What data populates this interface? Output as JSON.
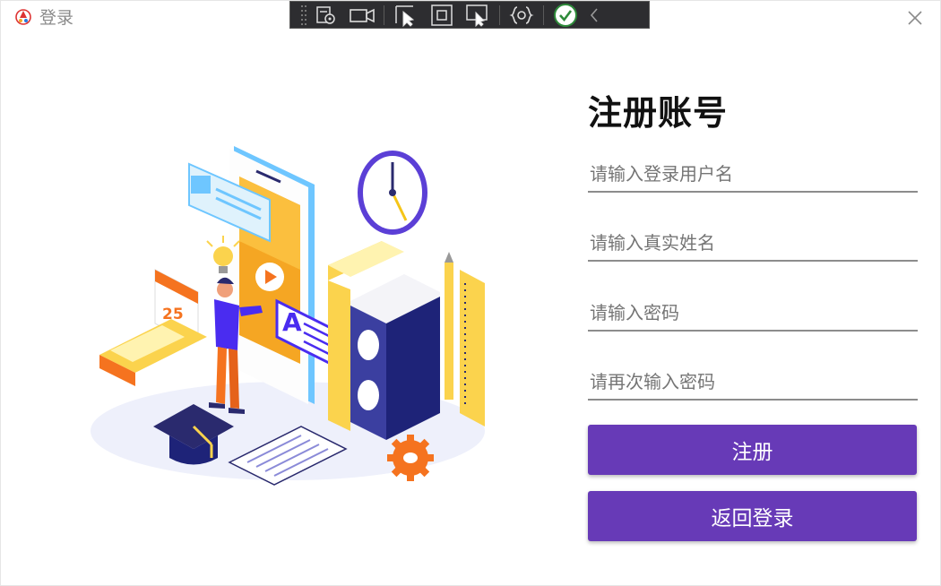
{
  "window": {
    "title": "登录",
    "close_icon": "close-icon"
  },
  "debug_toolbar": {
    "items": [
      "select-element-icon",
      "record-icon",
      "select-icon",
      "bounds-icon",
      "track-focus-icon",
      "binding-icon",
      "check-icon",
      "collapse-icon"
    ]
  },
  "form": {
    "title": "注册账号",
    "username_placeholder": "请输入登录用户名",
    "realname_placeholder": "请输入真实姓名",
    "password_placeholder": "请输入密码",
    "confirm_placeholder": "请再次输入密码",
    "register_label": "注册",
    "back_label": "返回登录"
  },
  "illustration": {
    "calendar_day": "25",
    "card_letter": "A"
  },
  "colors": {
    "primary": "#673ab7",
    "title_text": "#111111",
    "underline": "#8c8c8c"
  }
}
